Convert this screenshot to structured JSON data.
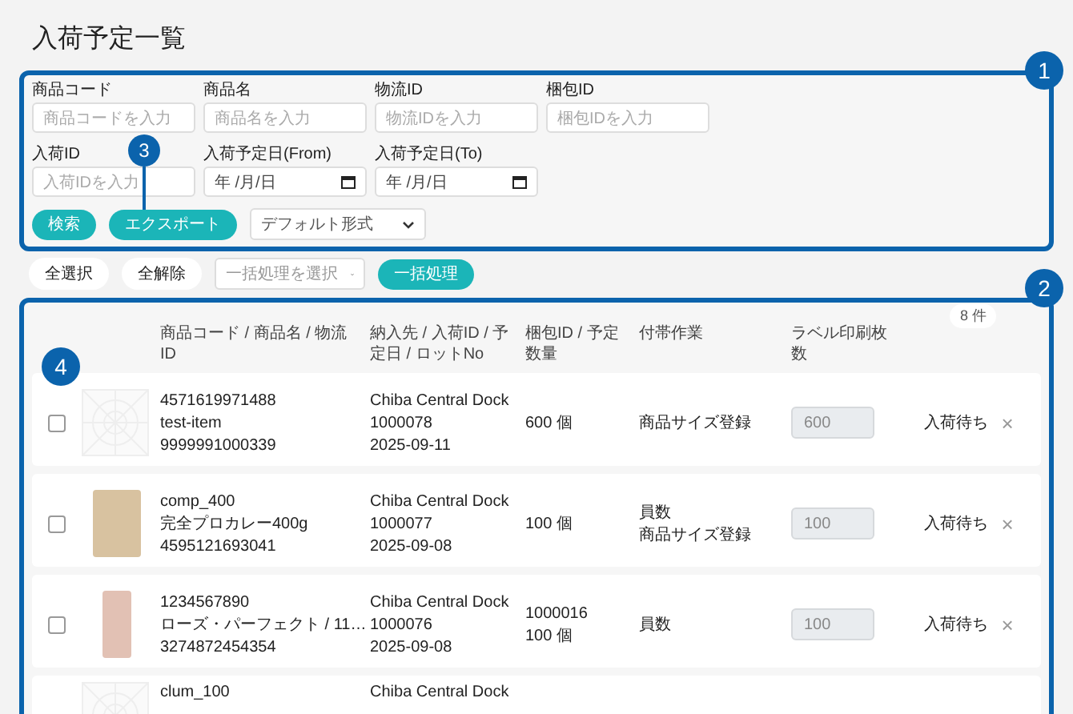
{
  "title": "入荷予定一覧",
  "filters": [
    {
      "kind": "text",
      "label": "商品コード",
      "placeholder": "商品コードを入力"
    },
    {
      "kind": "text",
      "label": "商品名",
      "placeholder": "商品名を入力"
    },
    {
      "kind": "text",
      "label": "物流ID",
      "placeholder": "物流IDを入力"
    },
    {
      "kind": "text",
      "label": "梱包ID",
      "placeholder": "梱包IDを入力"
    },
    {
      "kind": "text",
      "label": "入荷ID",
      "placeholder": "入荷IDを入力"
    },
    {
      "kind": "date",
      "label": "入荷予定日(From)",
      "placeholder": "年 /月/日"
    },
    {
      "kind": "date",
      "label": "入荷予定日(To)",
      "placeholder": "年 /月/日"
    }
  ],
  "search_button": "検索",
  "export_button": "エクスポート",
  "export_format": "デフォルト形式",
  "bulk": {
    "select_all": "全選択",
    "deselect_all": "全解除",
    "action_placeholder": "一括処理を選択",
    "apply": "一括処理"
  },
  "count": "8 件",
  "columns": [
    "商品コード / 商品名 / 物流ID",
    "納入先 / 入荷ID / 予定日 / ロットNo",
    "梱包ID / 予定数量",
    "付帯作業",
    "ラベル印刷枚数"
  ],
  "rows": [
    {
      "checked": false,
      "kind": "placeholder",
      "product": [
        "4571619971488",
        "test-item",
        "9999991000339"
      ],
      "destination": [
        "Chiba Central Dock",
        "1000078",
        "2025-09-11"
      ],
      "quantity": [
        "600 個"
      ],
      "tasks": [
        "商品サイズ登録"
      ],
      "label_count": "600",
      "status": "入荷待ち",
      "remove": "×"
    },
    {
      "checked": false,
      "kind": "photo",
      "product": [
        "comp_400",
        "完全プロカレー400g",
        "4595121693041"
      ],
      "destination": [
        "Chiba Central Dock",
        "1000077",
        "2025-09-08"
      ],
      "quantity": [
        "100 個"
      ],
      "tasks": [
        "員数",
        "商品サイズ登録"
      ],
      "label_count": "100",
      "status": "入荷待ち",
      "remove": "×"
    },
    {
      "checked": false,
      "kind": "photo",
      "product": [
        "1234567890",
        "ローズ・パーフェクト / 11…",
        "3274872454354"
      ],
      "destination": [
        "Chiba Central Dock",
        "1000076",
        "2025-09-08"
      ],
      "quantity": [
        "1000016",
        "100 個"
      ],
      "tasks": [
        "員数"
      ],
      "label_count": "100",
      "status": "入荷待ち",
      "remove": "×"
    },
    {
      "kind": "placeholder",
      "product": [
        "clum_100"
      ],
      "destination": [
        "Chiba Central Dock"
      ]
    }
  ],
  "annotations": [
    "1",
    "2",
    "3",
    "4"
  ]
}
